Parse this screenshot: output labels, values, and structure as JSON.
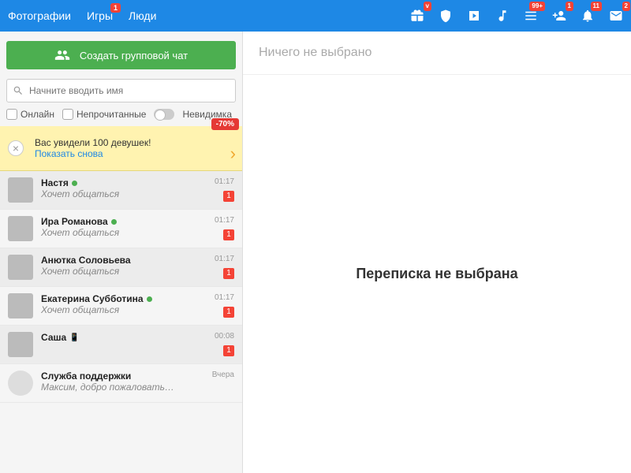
{
  "topbar": {
    "nav": [
      {
        "label": "Фотографии"
      },
      {
        "label": "Игры",
        "badge": "1"
      },
      {
        "label": "Люди"
      }
    ],
    "icons": [
      {
        "name": "gift-icon",
        "badge": "v"
      },
      {
        "name": "shield-icon"
      },
      {
        "name": "video-icon"
      },
      {
        "name": "music-icon"
      },
      {
        "name": "list-icon",
        "badge": "99+"
      },
      {
        "name": "friend-add-icon",
        "badge": "1"
      },
      {
        "name": "bell-icon",
        "badge": "11"
      },
      {
        "name": "mail-icon",
        "badge": "2"
      }
    ]
  },
  "sidebar": {
    "create_chat_label": "Создать групповой чат",
    "search_placeholder": "Начните вводить имя",
    "filters": {
      "online": "Онлайн",
      "unread": "Непрочитанные",
      "invisible": "Невидимка"
    },
    "promo": {
      "badge": "-70%",
      "text": "Вас увидели 100 девушек!",
      "link": "Показать снова"
    }
  },
  "conversations": [
    {
      "name": "Настя",
      "online": true,
      "preview": "Хочет общаться",
      "time": "01:17",
      "unread": "1"
    },
    {
      "name": "Ира Романова",
      "online": true,
      "preview": "Хочет общаться",
      "time": "01:17",
      "unread": "1"
    },
    {
      "name": "Анютка Соловьева",
      "online": false,
      "preview": "Хочет общаться",
      "time": "01:17",
      "unread": "1"
    },
    {
      "name": "Екатерина Субботина",
      "online": true,
      "preview": "Хочет общаться",
      "time": "01:17",
      "unread": "1"
    },
    {
      "name": "Саша",
      "online": false,
      "mobile": true,
      "preview": "",
      "time": "00:08",
      "unread": "1"
    },
    {
      "name": "Служба поддержки",
      "online": false,
      "support": true,
      "preview": "Максим, добро пожаловать в Фот",
      "time": "Вчера"
    }
  ],
  "main": {
    "header": "Ничего не выбрано",
    "empty": "Переписка не выбрана"
  }
}
